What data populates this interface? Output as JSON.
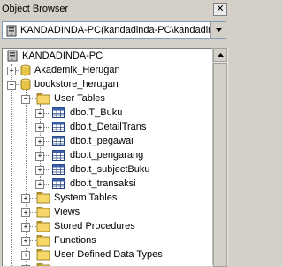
{
  "panel": {
    "title": "Object Browser",
    "close_glyph": "✕"
  },
  "server_combo": {
    "value": "KANDADINDA-PC(kandadinda-PC\\kandadinda"
  },
  "tree": {
    "root": "KANDADINDA-PC",
    "databases": [
      {
        "label": "Akademik_Herugan",
        "expander": "+"
      },
      {
        "label": "bookstore_herugan",
        "expander": "−"
      }
    ],
    "folders": {
      "user_tables": {
        "label": "User Tables",
        "expander": "−"
      },
      "system_tables": {
        "label": "System Tables",
        "expander": "+"
      },
      "views": {
        "label": "Views",
        "expander": "+"
      },
      "stored_procedures": {
        "label": "Stored Procedures",
        "expander": "+"
      },
      "functions": {
        "label": "Functions",
        "expander": "+"
      },
      "user_defined_types": {
        "label": "User Defined Data Types",
        "expander": "+"
      }
    },
    "tables": [
      {
        "label": "dbo.T_Buku",
        "expander": "+"
      },
      {
        "label": "dbo.t_DetailTrans",
        "expander": "+"
      },
      {
        "label": "dbo.t_pegawai",
        "expander": "+"
      },
      {
        "label": "dbo.t_pengarang",
        "expander": "+"
      },
      {
        "label": "dbo.t_subjectBuku",
        "expander": "+"
      },
      {
        "label": "dbo.t_transaksi",
        "expander": "+"
      }
    ],
    "partial_next": "+"
  },
  "colors": {
    "folder": "#f4d35e",
    "db": "#e8c547",
    "table": "#4a6ea8"
  }
}
